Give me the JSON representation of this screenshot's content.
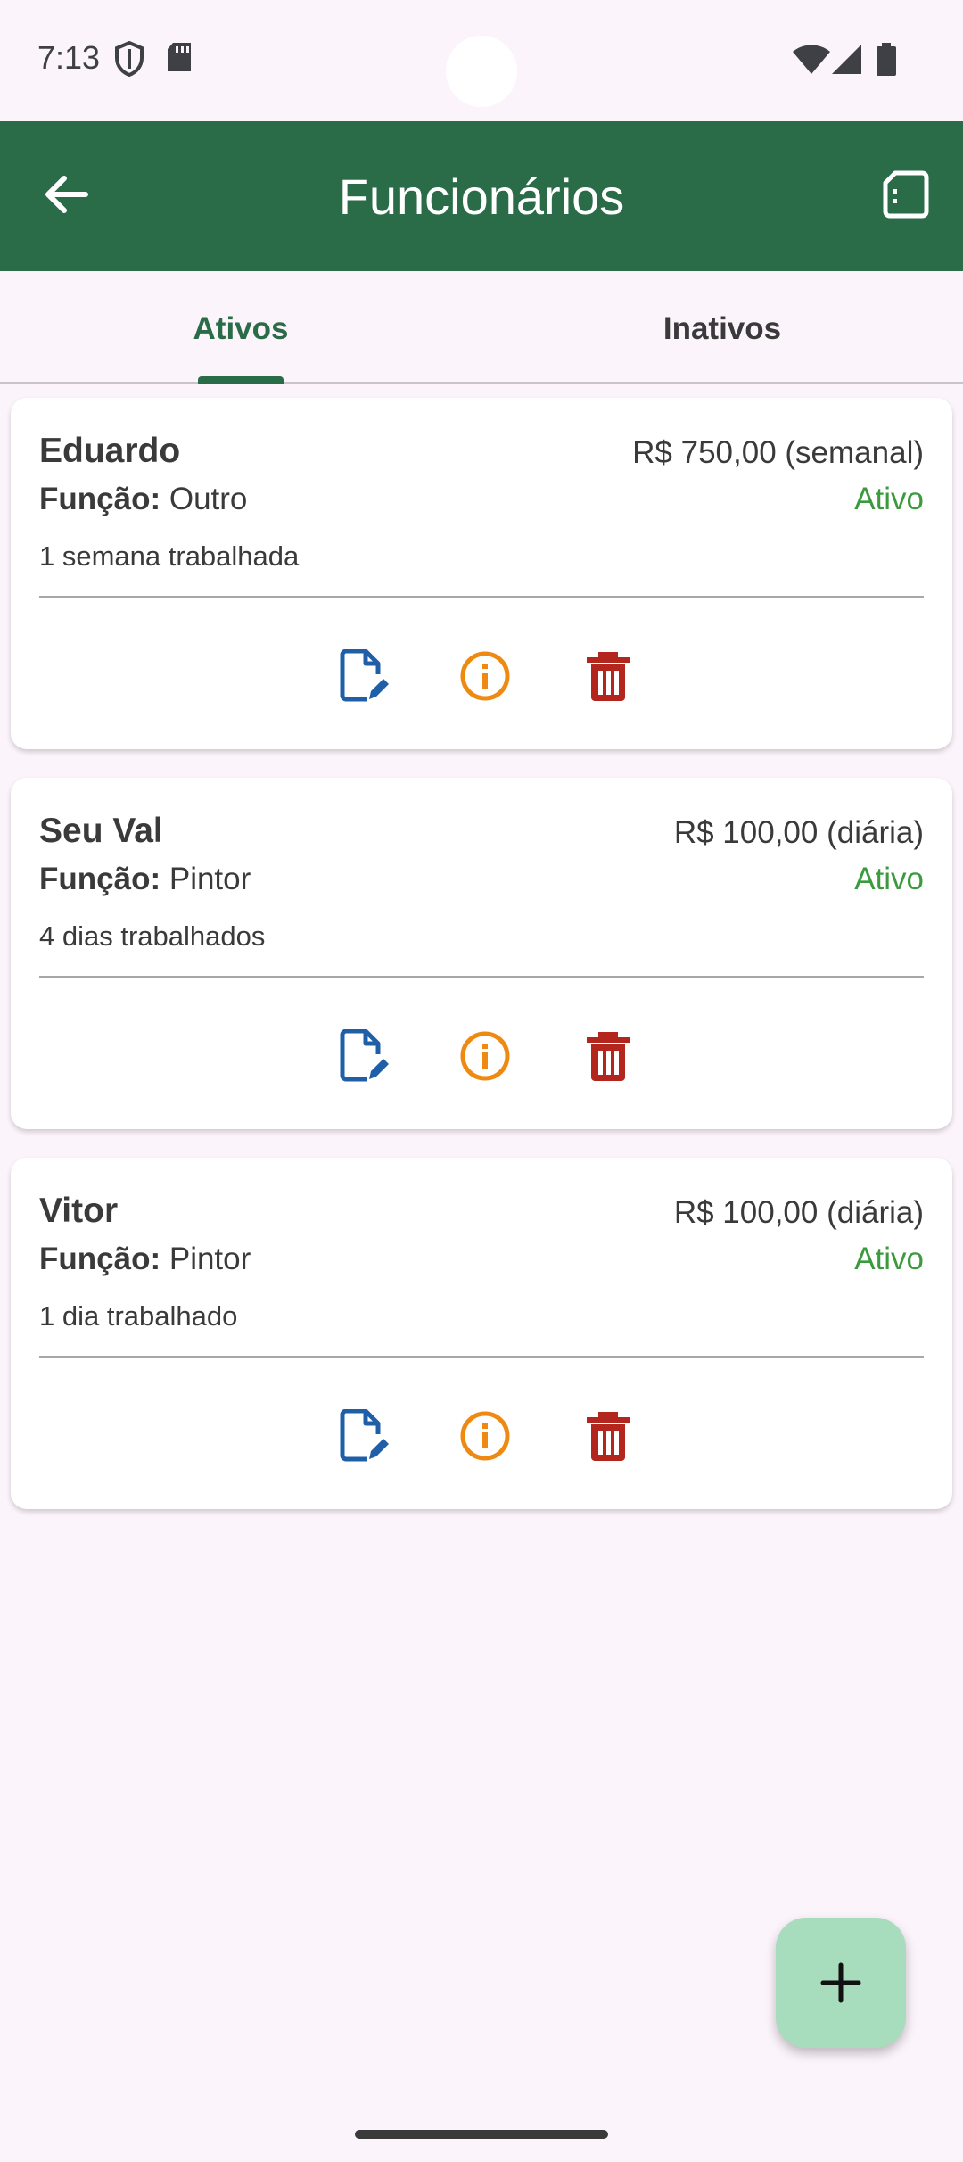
{
  "status_bar": {
    "time": "7:13",
    "icons": [
      "shield-icon",
      "sd-card-icon",
      "wifi-icon",
      "signal-icon",
      "battery-icon"
    ]
  },
  "app_bar": {
    "title": "Funcionários",
    "back_icon": "arrow-back-icon",
    "action_icon": "report-icon",
    "background": "#2a6b48"
  },
  "tabs": [
    {
      "label": "Ativos",
      "selected": true
    },
    {
      "label": "Inativos",
      "selected": false
    }
  ],
  "role_prefix": "Função:",
  "employees": [
    {
      "name": "Eduardo",
      "wage": "R$ 750,00 (semanal)",
      "role": "Outro",
      "status": "Ativo",
      "worked": "1 semana trabalhada"
    },
    {
      "name": "Seu Val",
      "wage": "R$ 100,00 (diária)",
      "role": "Pintor",
      "status": "Ativo",
      "worked": "4 dias trabalhados"
    },
    {
      "name": "Vitor",
      "wage": "R$ 100,00 (diária)",
      "role": "Pintor",
      "status": "Ativo",
      "worked": "1 dia trabalhado"
    }
  ],
  "card_actions": [
    {
      "icon": "edit-document-icon",
      "color": "#1f5fa8"
    },
    {
      "icon": "info-icon",
      "color": "#ee8a12"
    },
    {
      "icon": "trash-icon",
      "color": "#b3261e"
    }
  ],
  "fab": {
    "icon": "add-icon",
    "color": "#a7dcbc"
  },
  "colors": {
    "status_active": "#3b9a3d",
    "background": "#fcf4fb"
  }
}
